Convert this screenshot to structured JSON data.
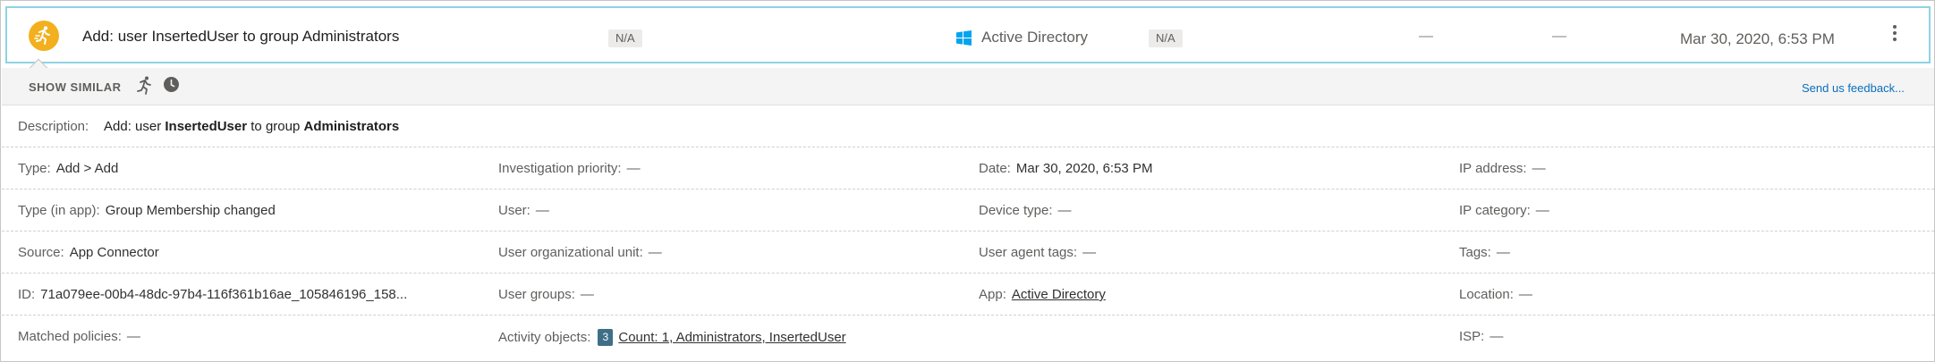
{
  "activity": {
    "title": "Add: user InsertedUser to group Administrators",
    "tag_1": "N/A",
    "app_name": "Active Directory",
    "tag_2": "N/A",
    "col_a": "—",
    "col_b": "—",
    "date": "Mar 30, 2020, 6:53 PM",
    "icon": "run-icon",
    "icon_color": "#f2b01e"
  },
  "toolbar": {
    "show_similar": "SHOW SIMILAR",
    "feedback": "Send us feedback..."
  },
  "description": {
    "label": "Description:",
    "prefix": "Add: user ",
    "user": "InsertedUser",
    "middle": " to group ",
    "group": "Administrators"
  },
  "details": {
    "type_label": "Type:",
    "type_value": "Add > Add",
    "priority_label": "Investigation priority:",
    "priority_value": "—",
    "date_label": "Date:",
    "date_value": "Mar 30, 2020, 6:53 PM",
    "ip_label": "IP address:",
    "ip_value": "—",
    "type_app_label": "Type (in app):",
    "type_app_value": "Group Membership changed",
    "user_label": "User:",
    "user_value": "—",
    "device_label": "Device type:",
    "device_value": "—",
    "ipcat_label": "IP category:",
    "ipcat_value": "—",
    "source_label": "Source:",
    "source_value": "App Connector",
    "ou_label": "User organizational unit:",
    "ou_value": "—",
    "uatags_label": "User agent tags:",
    "uatags_value": "—",
    "tags_label": "Tags:",
    "tags_value": "—",
    "id_label": "ID:",
    "id_value": "71a079ee-00b4-48dc-97b4-116f361b16ae_105846196_158...",
    "groups_label": "User groups:",
    "groups_value": "—",
    "app_label": "App:",
    "app_value": "Active Directory",
    "location_label": "Location:",
    "location_value": "—",
    "policies_label": "Matched policies:",
    "policies_value": "—",
    "objects_label": "Activity objects:",
    "objects_count": "3",
    "objects_value": "Count: 1, Administrators, InsertedUser",
    "isp_label": "ISP:",
    "isp_value": "—"
  },
  "colors": {
    "accent_border": "#8fd2e3",
    "link": "#0a6ebd",
    "badge": "#3f6f86",
    "windows_blue": "#00a4ef"
  }
}
